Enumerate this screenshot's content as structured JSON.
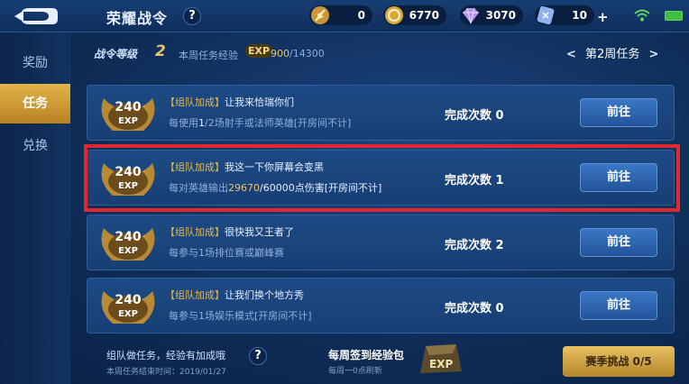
{
  "header": {
    "title": "荣耀战令",
    "help_icon": "?",
    "currencies": [
      {
        "icon": "feather-icon",
        "value": "0"
      },
      {
        "icon": "gold-coin-icon",
        "value": "6770"
      },
      {
        "icon": "diamond-icon",
        "value": "3070"
      },
      {
        "icon": "ticket-icon",
        "value": "10"
      }
    ],
    "plus": "+"
  },
  "sidebar": {
    "items": [
      {
        "label": "奖励",
        "active": false
      },
      {
        "label": "任务",
        "active": true
      },
      {
        "label": "兑换",
        "active": false
      }
    ]
  },
  "pass": {
    "level_label": "战令等级",
    "level": "2",
    "exp_label": "本周任务经验",
    "exp_badge": "EXP",
    "exp_current": "900",
    "exp_total": "/14300",
    "week_label": "第2周任务",
    "prev_arrow": "<",
    "next_arrow": ">"
  },
  "tasks": [
    {
      "exp": "240",
      "exp_unit": "EXP",
      "tag": "【组队加成】",
      "name": "让我来恰瑞你们",
      "desc_a": "每使用",
      "desc_hl": "1",
      "desc_b": "/2场射手或法师英雄[开房间不计]",
      "count_label": "完成次数",
      "count": "0",
      "button": "前往"
    },
    {
      "exp": "240",
      "exp_unit": "EXP",
      "tag": "【组队加成】",
      "name": "我这一下你屏幕会变黑",
      "desc_a": "每对英雄输出",
      "desc_hl": "29670",
      "desc_b": "/60000点伤害[开房间不计]",
      "count_label": "完成次数",
      "count": "1",
      "button": "前往"
    },
    {
      "exp": "240",
      "exp_unit": "EXP",
      "tag": "【组队加成】",
      "name": "很快我又王者了",
      "desc_a": "每参与",
      "desc_hl": "",
      "desc_b": "1场排位赛或巅峰赛",
      "count_label": "完成次数",
      "count": "2",
      "button": "前往"
    },
    {
      "exp": "240",
      "exp_unit": "EXP",
      "tag": "【组队加成】",
      "name": "让我们换个地方秀",
      "desc_a": "每参与",
      "desc_hl": "",
      "desc_b": "1场娱乐模式[开房间不计]",
      "count_label": "完成次数",
      "count": "0",
      "button": "前往"
    }
  ],
  "footer": {
    "team_text": "组队做任务，经验有加成哦",
    "week_end": "本周任务结束时间：2019/01/27",
    "sign_title": "每周签到经验包",
    "sign_sub": "每周一0点刷新",
    "season_button": "赛季挑战 0/5"
  },
  "colors": {
    "accent_gold": "#e6c46c",
    "highlight_red": "#e0282e",
    "button_blue": "#3a77c5"
  }
}
